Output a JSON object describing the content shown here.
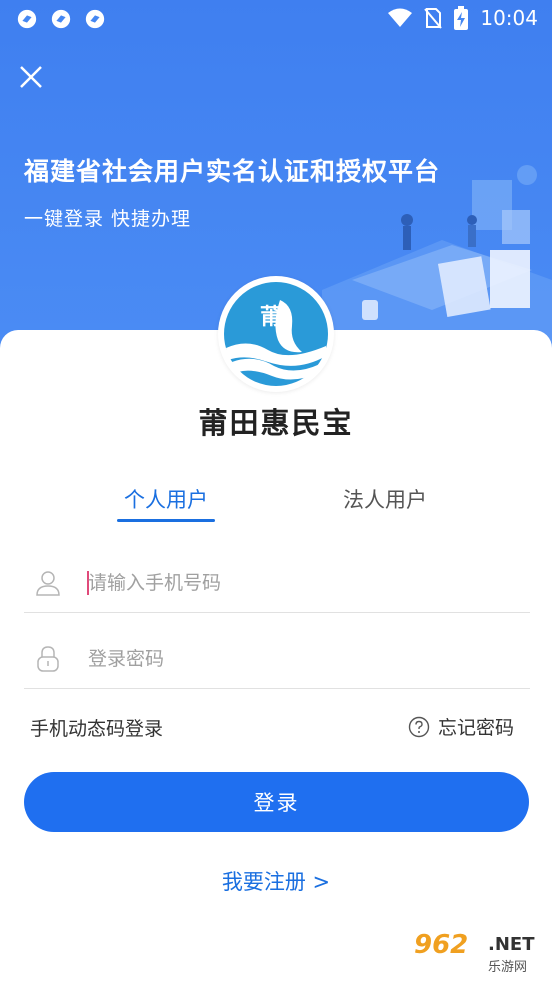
{
  "status_bar": {
    "time": "10:04",
    "left_icons": [
      "app-notification-icon",
      "app-notification-icon",
      "app-notification-icon"
    ],
    "right_icons": [
      "wifi-icon",
      "no-sim-icon",
      "battery-charging-icon"
    ]
  },
  "hero": {
    "title": "福建省社会用户实名认证和授权平台",
    "subtitle": "一键登录 快捷办理",
    "colors": {
      "background": "#4587f2",
      "text": "#ffffff"
    }
  },
  "app": {
    "name": "莆田惠民宝",
    "logo_text": "莆",
    "logo_color": "#2a9ad8"
  },
  "tabs": [
    {
      "label": "个人用户",
      "active": true
    },
    {
      "label": "法人用户",
      "active": false
    }
  ],
  "form": {
    "phone_placeholder": "请输入手机号码",
    "password_placeholder": "登录密码"
  },
  "links": {
    "sms_login": "手机动态码登录",
    "forgot_password": "忘记密码",
    "register": "我要注册 >"
  },
  "login_button": "登录",
  "watermark": {
    "brand": "962",
    "domain": ".NET",
    "sub": "乐游网"
  },
  "colors": {
    "accent": "#1f6ff0",
    "tab_active": "#1a6fe0",
    "text_primary": "#222222"
  }
}
